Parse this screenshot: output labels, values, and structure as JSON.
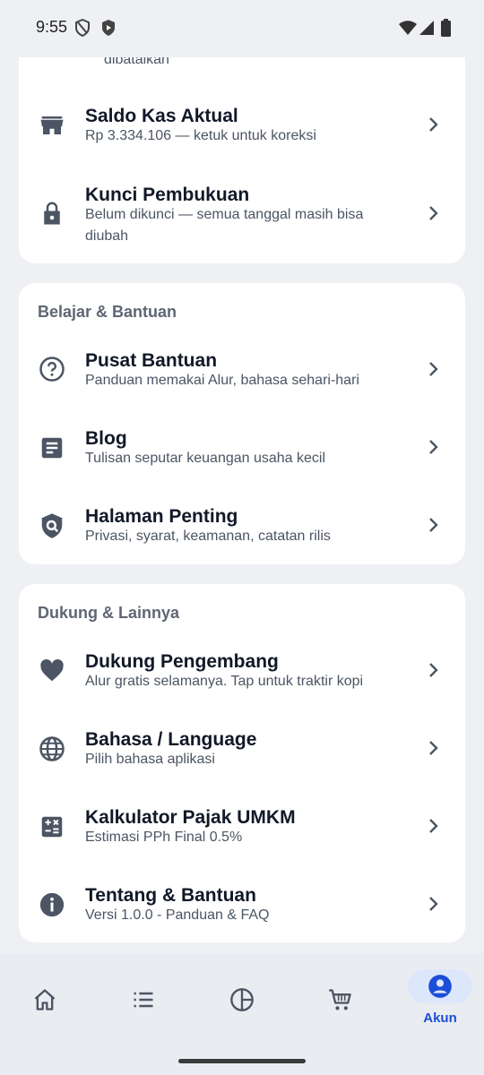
{
  "status": {
    "time": "9:55"
  },
  "partial_text": "dibatalkan",
  "top_card": {
    "items": [
      {
        "title": "Saldo Kas Aktual",
        "subtitle": "Rp 3.334.106 — ketuk untuk koreksi",
        "icon": "store-icon"
      },
      {
        "title": "Kunci Pembukuan",
        "subtitle": "Belum dikunci — semua tanggal masih bisa diubah",
        "icon": "lock-icon"
      }
    ]
  },
  "learn_section": {
    "title": "Belajar & Bantuan",
    "items": [
      {
        "title": "Pusat Bantuan",
        "subtitle": "Panduan memakai Alur, bahasa sehari-hari",
        "icon": "help-circle-icon"
      },
      {
        "title": "Blog",
        "subtitle": "Tulisan seputar keuangan usaha kecil",
        "icon": "article-icon"
      },
      {
        "title": "Halaman Penting",
        "subtitle": "Privasi, syarat, keamanan, catatan rilis",
        "icon": "shield-search-icon"
      }
    ]
  },
  "support_section": {
    "title": "Dukung & Lainnya",
    "items": [
      {
        "title": "Dukung Pengembang",
        "subtitle": "Alur gratis selamanya. Tap untuk traktir kopi",
        "icon": "heart-icon"
      },
      {
        "title": "Bahasa / Language",
        "subtitle": "Pilih bahasa aplikasi",
        "icon": "globe-icon"
      },
      {
        "title": "Kalkulator Pajak UMKM",
        "subtitle": "Estimasi PPh Final 0.5%",
        "icon": "calculator-icon"
      },
      {
        "title": "Tentang & Bantuan",
        "subtitle": "Versi 1.0.0 - Panduan & FAQ",
        "icon": "info-icon"
      }
    ]
  },
  "bottom_nav": {
    "active_label": "Akun",
    "items": [
      "home-icon",
      "list-icon",
      "pie-chart-icon",
      "cart-icon",
      "account-icon"
    ],
    "accent_color": "#1d4ed8"
  }
}
